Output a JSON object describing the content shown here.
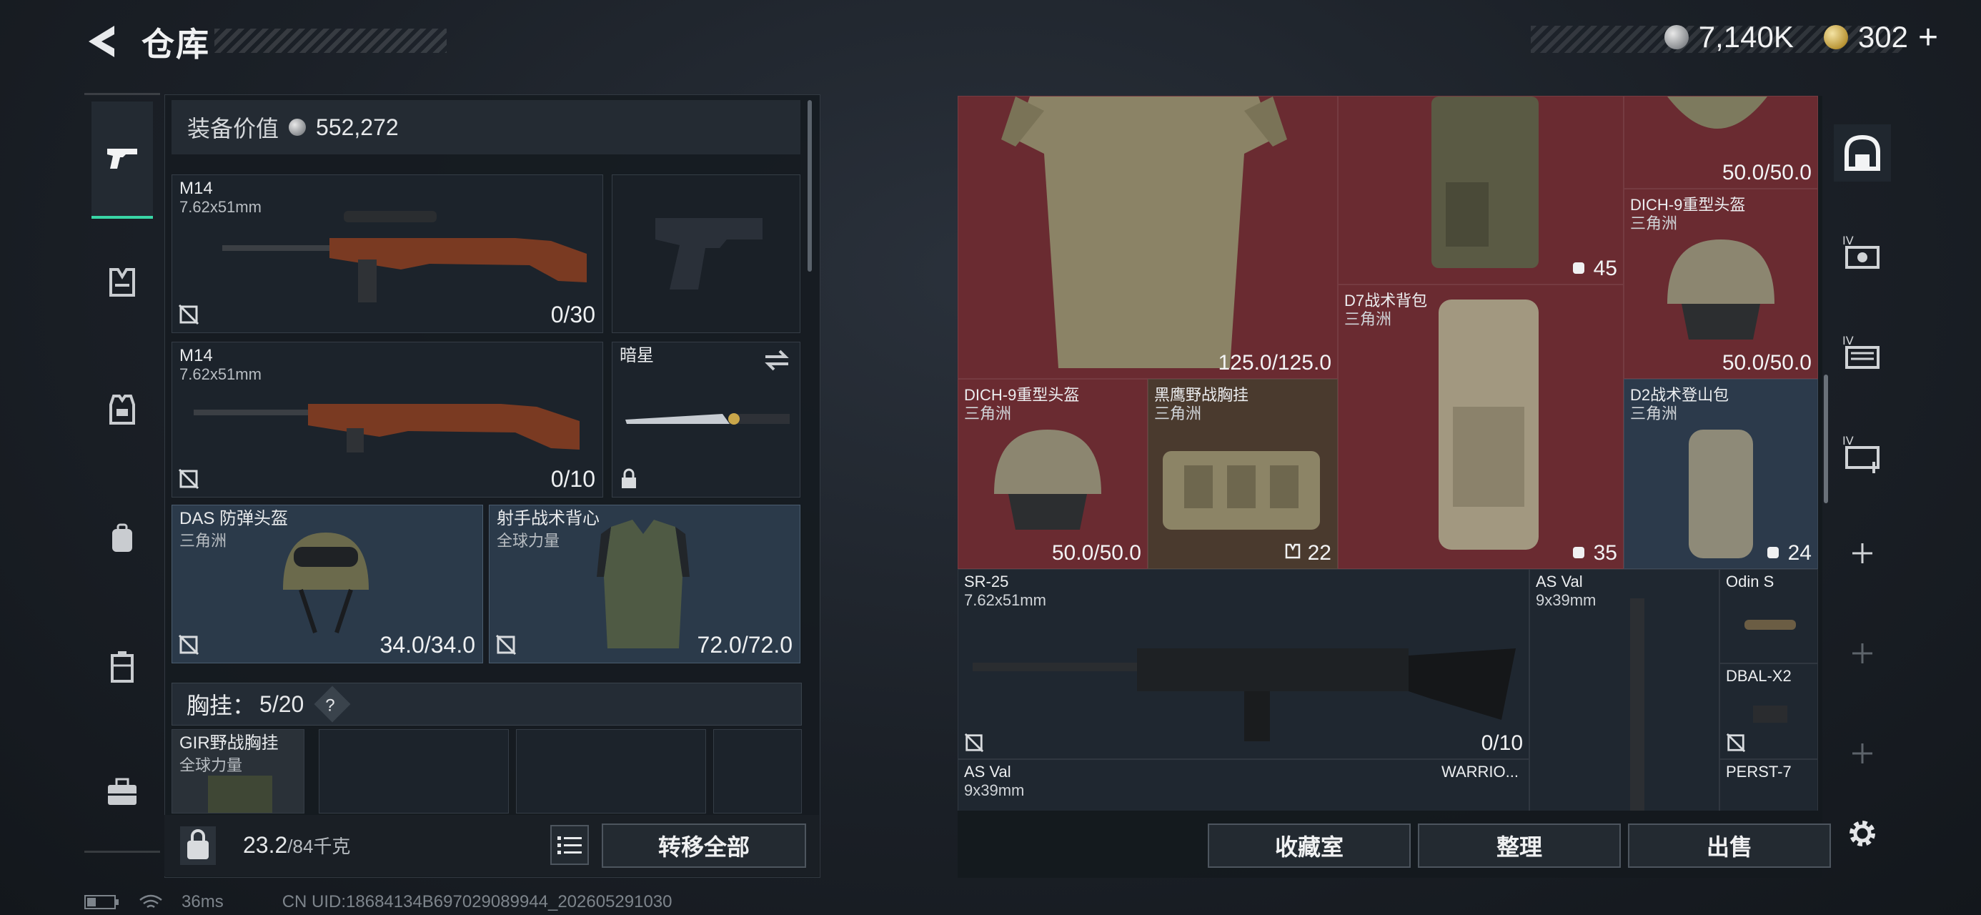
{
  "header": {
    "title": "仓库",
    "silver": "7,140K",
    "gold": "302",
    "gold_add": "+"
  },
  "left": {
    "equip_label": "装备价值",
    "equip_value": "552,272",
    "slots": {
      "primary": {
        "name": "M14",
        "caliber": "7.62x51mm",
        "ammo": "0/30"
      },
      "secondary": {
        "name": "M14",
        "caliber": "7.62x51mm",
        "ammo": "0/10"
      },
      "melee": {
        "name": "暗星"
      },
      "helmet": {
        "name": "DAS 防弹头盔",
        "faction": "三角洲",
        "durability": "34.0/34.0"
      },
      "armor": {
        "name": "射手战术背心",
        "faction": "全球力量",
        "durability": "72.0/72.0"
      }
    },
    "chest_label": "胸挂：",
    "chest_count": "5/20",
    "chest_help": "?",
    "chest_item": {
      "name": "GIR野战胸挂",
      "faction": "全球力量"
    },
    "weight": "23.2",
    "weight_max": "/84千克",
    "transfer_all": "转移全部"
  },
  "storage": {
    "items": [
      {
        "id": "armor-top",
        "count": "125.0/125.0"
      },
      {
        "id": "backpack-top",
        "count": "45"
      },
      {
        "id": "helmet-top",
        "count": "50.0/50.0"
      },
      {
        "id": "dich9-right",
        "name": "DICH-9重型头盔",
        "faction": "三角洲",
        "count": "50.0/50.0"
      },
      {
        "id": "d7-backpack",
        "name": "D7战术背包",
        "faction": "三角洲",
        "count": "35"
      },
      {
        "id": "dich9-left",
        "name": "DICH-9重型头盔",
        "faction": "三角洲",
        "count": "50.0/50.0"
      },
      {
        "id": "black-eagle",
        "name": "黑鹰野战胸挂",
        "faction": "三角洲",
        "count": "22"
      },
      {
        "id": "d2-pack",
        "name": "D2战术登山包",
        "faction": "三角洲",
        "count": "24"
      },
      {
        "id": "sr25",
        "name": "SR-25",
        "caliber": "7.62x51mm",
        "count": "0/10"
      },
      {
        "id": "asval-1",
        "name": "AS Val",
        "caliber": "9x39mm"
      },
      {
        "id": "odin",
        "name": "Odin S"
      },
      {
        "id": "dbal",
        "name": "DBAL-X2"
      },
      {
        "id": "asval-2",
        "name": "AS Val",
        "caliber": "9x39mm"
      },
      {
        "id": "warrior",
        "name": "WARRIO..."
      },
      {
        "id": "perst",
        "name": "PERST-7"
      }
    ],
    "btn_collection": "收藏室",
    "btn_sort": "整理",
    "btn_sell": "出售"
  },
  "status": {
    "ping": "36ms",
    "uid": "CN UID:18684134B697029089944_202605291030"
  },
  "icons": {
    "accent": "#39d6a6",
    "red_cell": "#6a2b31",
    "blue_cell": "#2c3a4b"
  }
}
